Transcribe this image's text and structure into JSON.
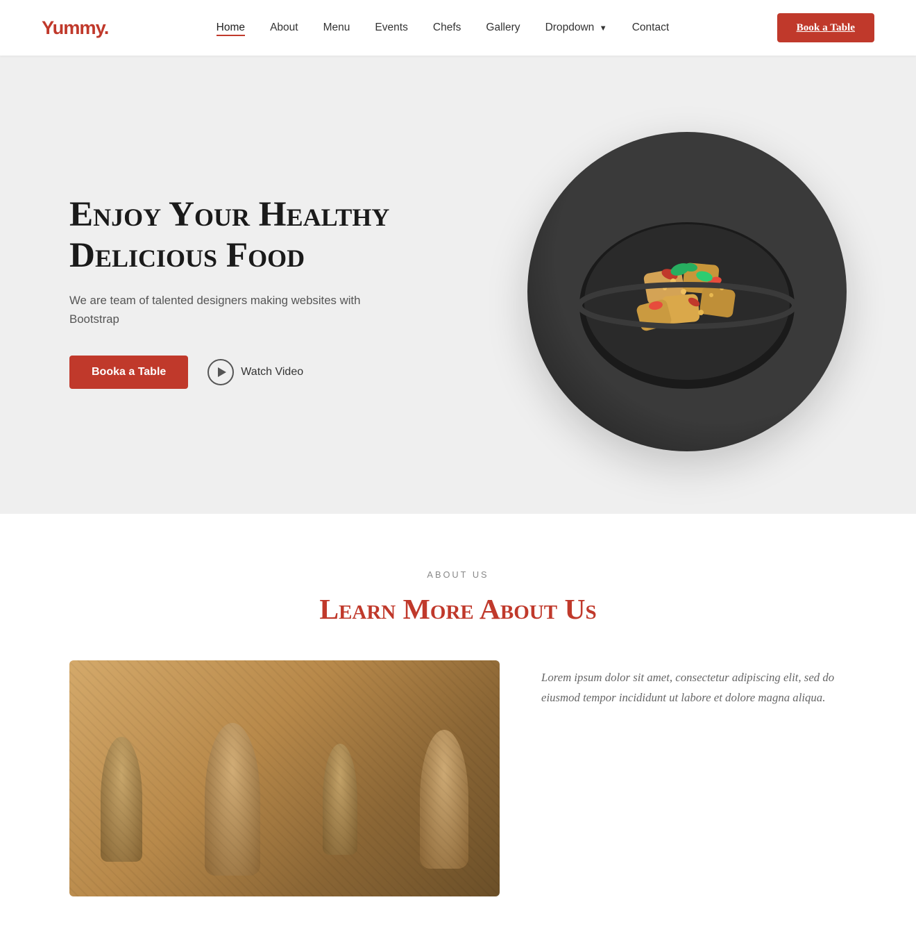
{
  "brand": {
    "name": "Yummy",
    "dot": "."
  },
  "nav": {
    "links": [
      {
        "id": "home",
        "label": "Home",
        "active": true
      },
      {
        "id": "about",
        "label": "About",
        "active": false
      },
      {
        "id": "menu",
        "label": "Menu",
        "active": false
      },
      {
        "id": "events",
        "label": "Events",
        "active": false
      },
      {
        "id": "chefs",
        "label": "Chefs",
        "active": false
      },
      {
        "id": "gallery",
        "label": "Gallery",
        "active": false
      },
      {
        "id": "dropdown",
        "label": "Dropdown",
        "has_arrow": true,
        "active": false
      },
      {
        "id": "contact",
        "label": "Contact",
        "active": false
      }
    ],
    "cta_label": "Book a Table"
  },
  "hero": {
    "title": "Enjoy Your Healthy Delicious Food",
    "subtitle": "We are team of talented designers making websites with Bootstrap",
    "book_label": "Booka a Table",
    "watch_label": "Watch Video"
  },
  "about": {
    "section_label": "ABOUT US",
    "heading_plain": "Learn More ",
    "heading_accent": "About Us",
    "body_text": "Lorem ipsum dolor sit amet, consectetur adipiscing elit, sed do eiusmod tempor incididunt ut labore et dolore magna aliqua."
  }
}
